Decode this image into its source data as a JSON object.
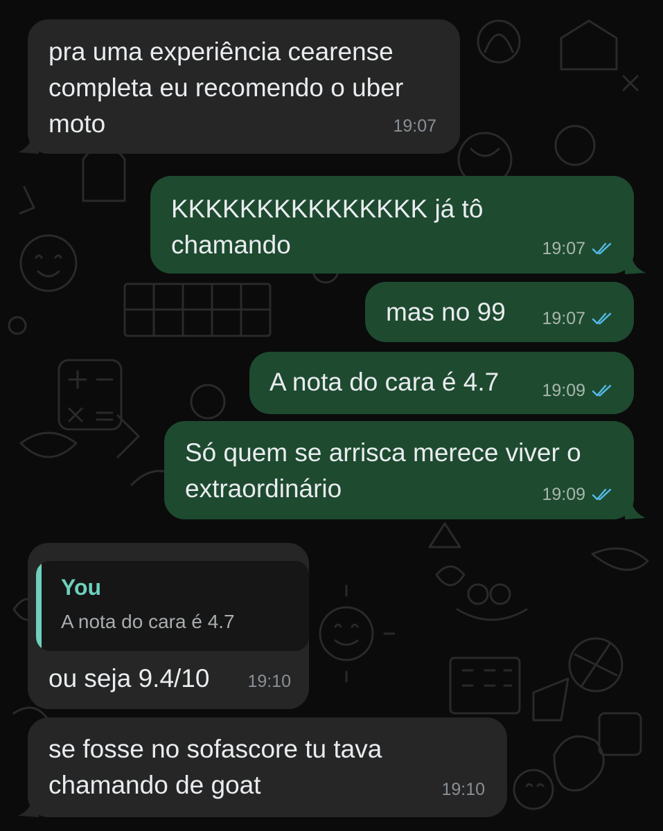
{
  "theme": {
    "background": "#0b0b0b",
    "incoming_bubble": "#262626",
    "outgoing_bubble": "#1e4a30",
    "quote_accent": "#6ed0bd",
    "read_ticks": "#53bdeb"
  },
  "messages": [
    {
      "direction": "incoming",
      "lines": [
        "pra uma experiência cearense",
        "completa eu recomendo o uber",
        "moto"
      ],
      "time": "19:07"
    },
    {
      "direction": "outgoing",
      "lines": [
        "KKKKKKKKKKKKKKK já tô",
        "chamando"
      ],
      "time": "19:07",
      "status_icon": "double-check-read-icon"
    },
    {
      "direction": "outgoing",
      "lines": [
        "mas no 99"
      ],
      "time": "19:07",
      "status_icon": "double-check-read-icon"
    },
    {
      "direction": "outgoing",
      "lines": [
        "A nota do cara é 4.7"
      ],
      "time": "19:09",
      "status_icon": "double-check-read-icon"
    },
    {
      "direction": "outgoing",
      "lines": [
        "Só quem se arrisca merece viver o",
        "extraordinário"
      ],
      "time": "19:09",
      "status_icon": "double-check-read-icon"
    },
    {
      "direction": "incoming",
      "quote": {
        "author": "You",
        "text": "A nota do cara é 4.7"
      },
      "lines": [
        "ou seja 9.4/10"
      ],
      "time": "19:10"
    },
    {
      "direction": "incoming",
      "lines": [
        "se fosse no sofascore tu tava",
        "chamando de goat"
      ],
      "time": "19:10"
    }
  ]
}
